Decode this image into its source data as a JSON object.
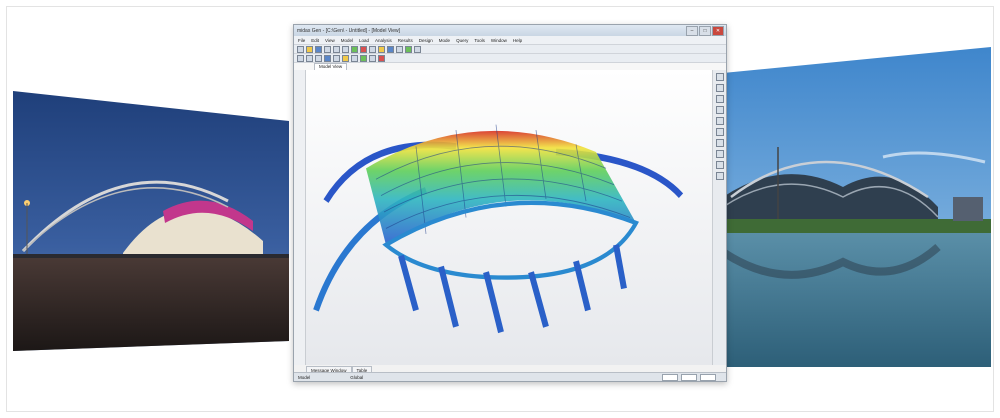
{
  "app": {
    "title": "midas Gen - [C:\\Gen\\ - Untitled] - [Model View]",
    "window_controls": {
      "minimize": "–",
      "maximize": "□",
      "close": "✕"
    },
    "menu": [
      "File",
      "Edit",
      "View",
      "Model",
      "Load",
      "Analysis",
      "Results",
      "Design",
      "Mode",
      "Query",
      "Tools",
      "Window",
      "Help"
    ],
    "document_tab": "Model View",
    "bottom_tabs": [
      "Message Window",
      "Table"
    ],
    "status": {
      "coord": "Global",
      "mode": "Model"
    }
  },
  "left_photo": {
    "icon": "stadium-night-photo"
  },
  "right_photo": {
    "icon": "stadium-day-photo"
  },
  "colors": {
    "window_border": "#9aa3ad",
    "close_button": "#c9473d",
    "titlebar": "#c9d6e4"
  }
}
